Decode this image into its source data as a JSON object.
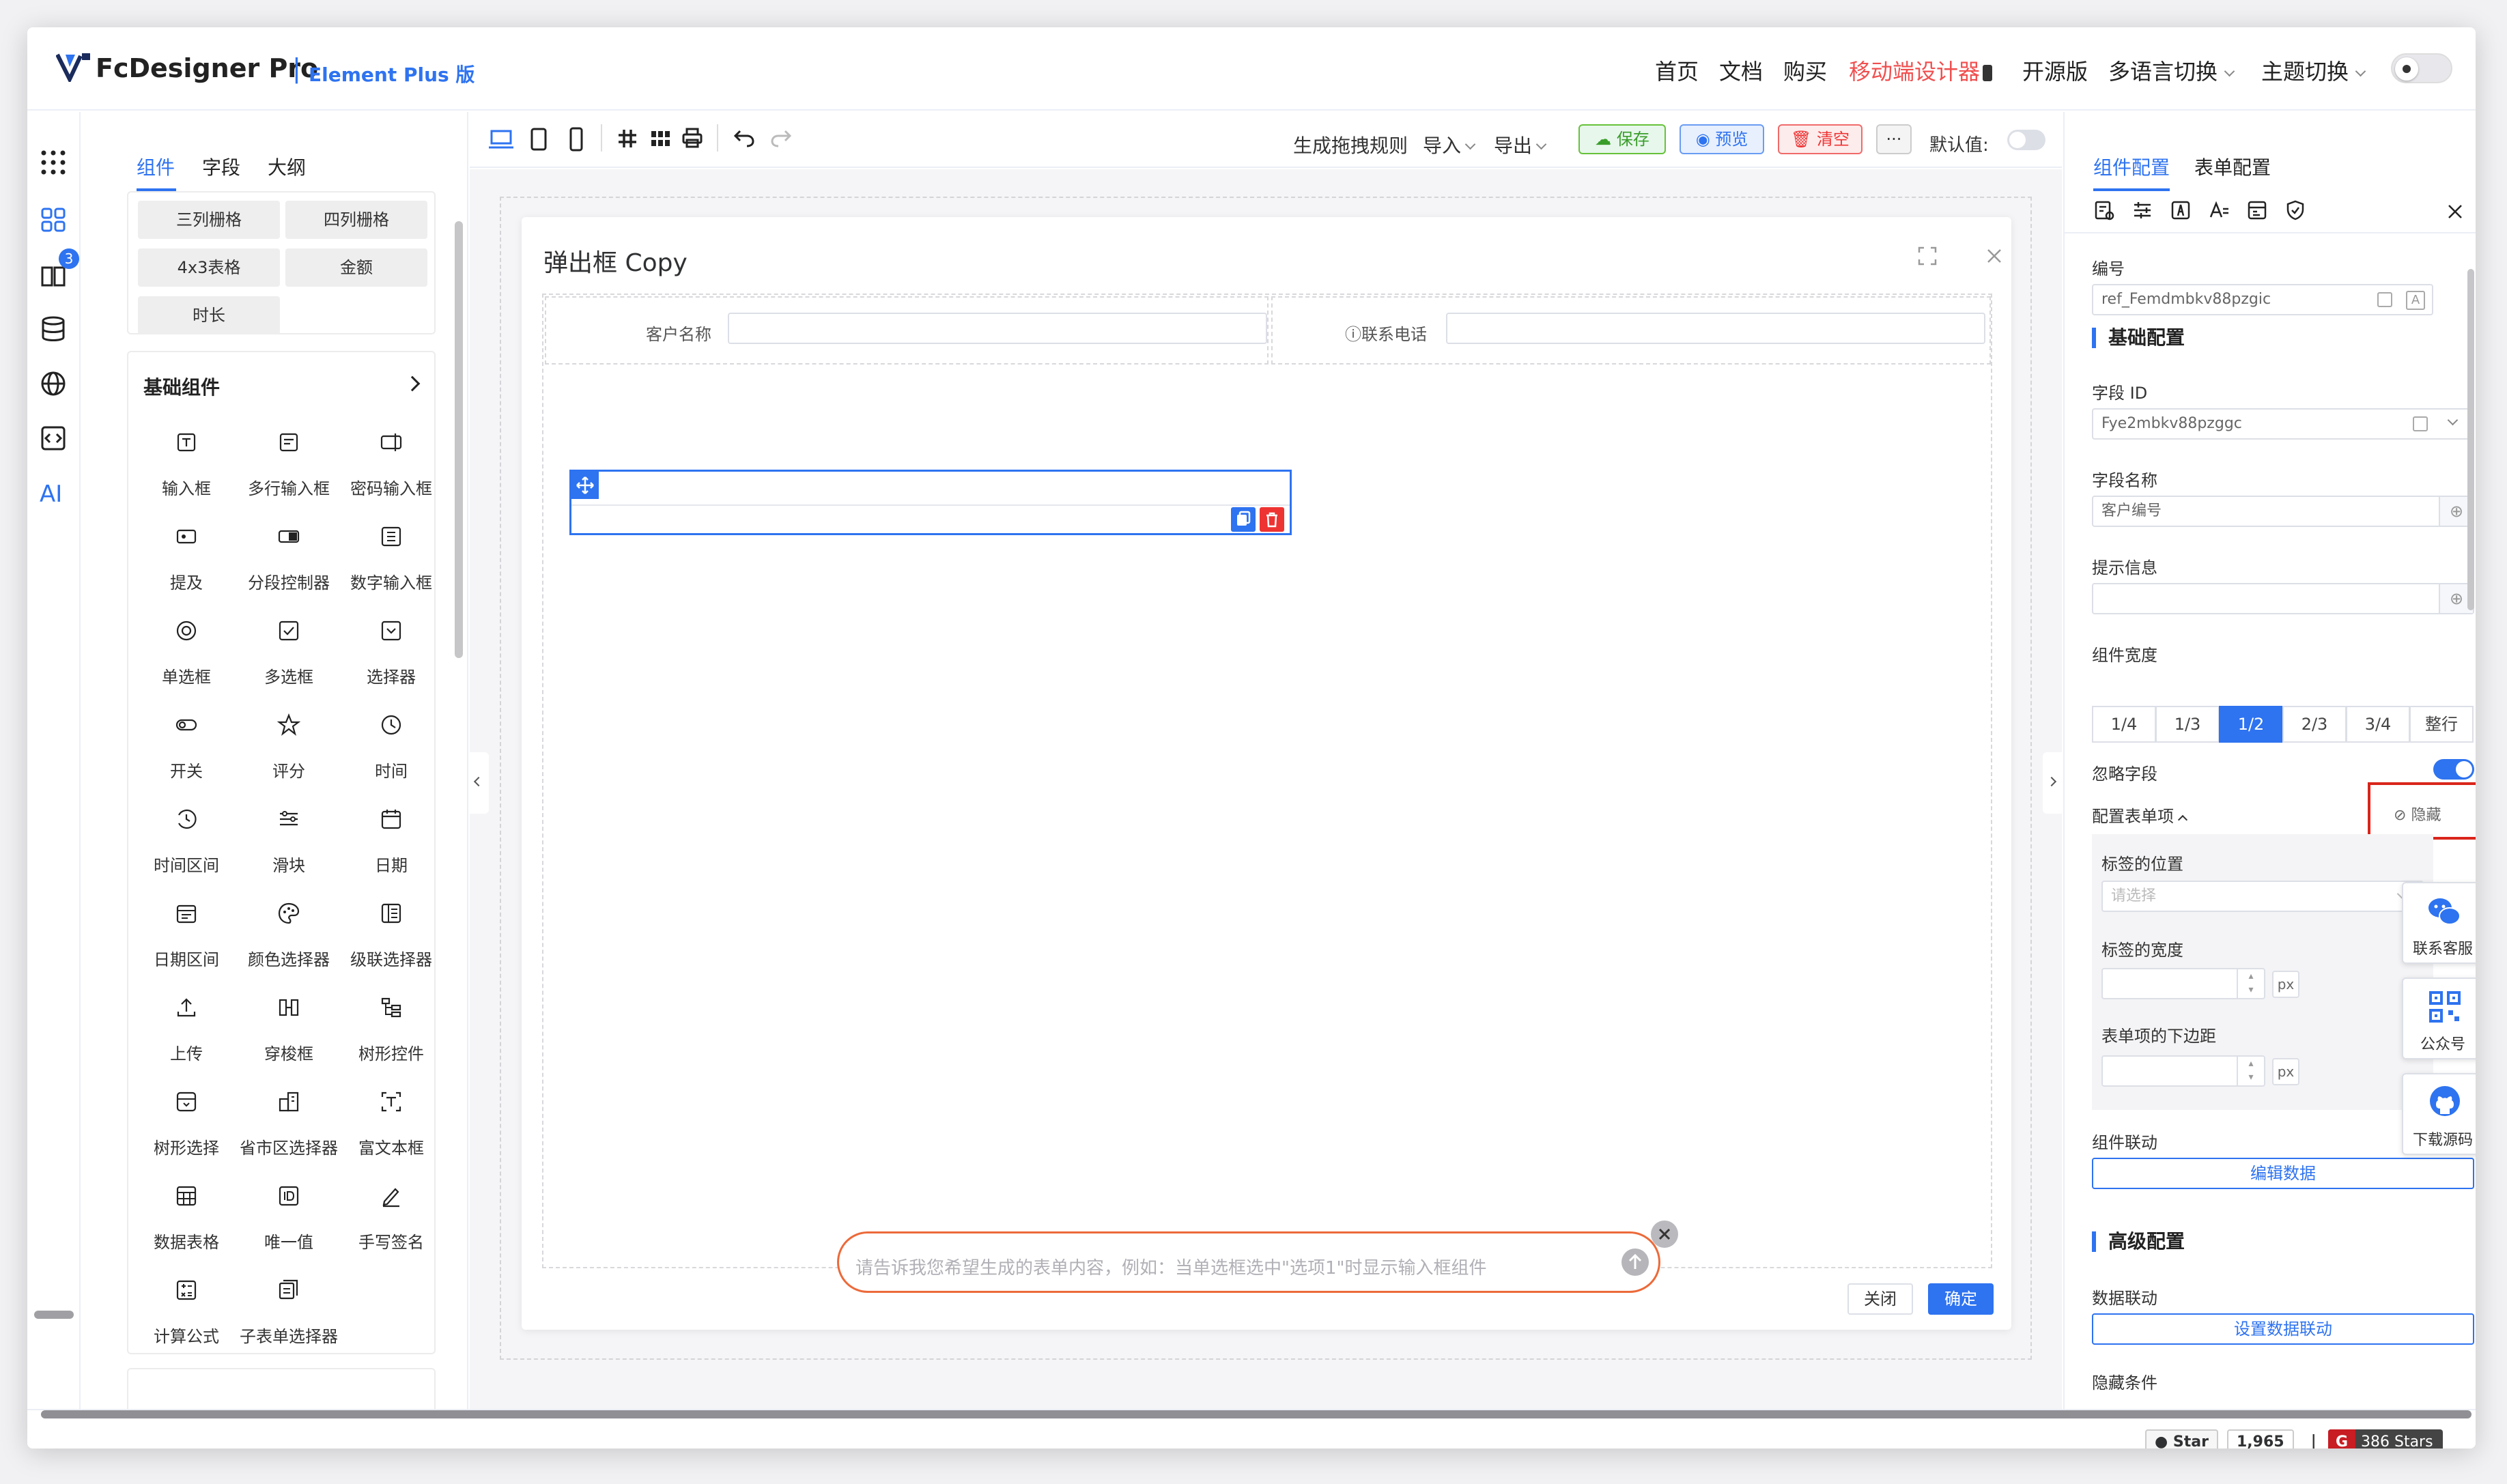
{
  "app": {
    "title": "FcDesigner Pro",
    "sep": "|",
    "subtitle": "Element Plus 版"
  },
  "topnav": {
    "items": [
      "首页",
      "文档",
      "购买",
      "移动端设计器",
      "开源版",
      "多语言切换",
      "主题切换"
    ],
    "active_color": "#f04f4f"
  },
  "left": {
    "tabs": [
      "组件",
      "字段",
      "大纲"
    ],
    "badge": "3",
    "ai_label": "AI",
    "layout_chips": [
      "三列栅格",
      "四列栅格",
      "4x3表格",
      "金额",
      "时长"
    ],
    "basic_title": "基础组件",
    "components": [
      {
        "label": "输入框",
        "icon": "input-icon"
      },
      {
        "label": "多行输入框",
        "icon": "textarea-icon"
      },
      {
        "label": "密码输入框",
        "icon": "password-icon"
      },
      {
        "label": "提及",
        "icon": "mention-icon"
      },
      {
        "label": "分段控制器",
        "icon": "segmented-icon"
      },
      {
        "label": "数字输入框",
        "icon": "number-icon"
      },
      {
        "label": "单选框",
        "icon": "radio-icon"
      },
      {
        "label": "多选框",
        "icon": "checkbox-icon"
      },
      {
        "label": "选择器",
        "icon": "select-icon"
      },
      {
        "label": "开关",
        "icon": "switch-icon"
      },
      {
        "label": "评分",
        "icon": "star-icon"
      },
      {
        "label": "时间",
        "icon": "clock-icon"
      },
      {
        "label": "时间区间",
        "icon": "time-range-icon"
      },
      {
        "label": "滑块",
        "icon": "slider-icon"
      },
      {
        "label": "日期",
        "icon": "calendar-icon"
      },
      {
        "label": "日期区间",
        "icon": "date-range-icon"
      },
      {
        "label": "颜色选择器",
        "icon": "palette-icon"
      },
      {
        "label": "级联选择器",
        "icon": "cascader-icon"
      },
      {
        "label": "上传",
        "icon": "upload-icon"
      },
      {
        "label": "穿梭框",
        "icon": "transfer-icon"
      },
      {
        "label": "树形控件",
        "icon": "tree-icon"
      },
      {
        "label": "树形选择",
        "icon": "tree-select-icon"
      },
      {
        "label": "省市区选择器",
        "icon": "region-icon"
      },
      {
        "label": "富文本框",
        "icon": "editor-icon"
      },
      {
        "label": "数据表格",
        "icon": "table-icon"
      },
      {
        "label": "唯一值",
        "icon": "id-icon"
      },
      {
        "label": "手写签名",
        "icon": "signature-icon"
      },
      {
        "label": "计算公式",
        "icon": "calculator-icon"
      },
      {
        "label": "子表单选择器",
        "icon": "subform-icon"
      }
    ]
  },
  "toolbar": {
    "gen_rule": "生成拖拽规则",
    "import": "导入",
    "export": "导出",
    "save": "保存",
    "preview": "预览",
    "clear": "清空",
    "more": "···",
    "default_label": "默认值:"
  },
  "canvas": {
    "dialog_title": "弹出框 Copy",
    "field1_label": "客户名称",
    "field2_label": "ⓘ联系电话",
    "close_btn": "关闭",
    "ok_btn": "确定",
    "ai_placeholder": "请告诉我您希望生成的表单内容，例如：当单选框选中\"选项1\"时显示输入框组件"
  },
  "right": {
    "tabs": [
      "组件配置",
      "表单配置"
    ],
    "ref_label": "编号",
    "ref_value": "ref_Femdmbkv88pzgic",
    "basic_section": "基础配置",
    "field_id_label": "字段 ID",
    "field_id_value": "Fye2mbkv88pzggc",
    "field_name_label": "字段名称",
    "field_name_value": "客户编号",
    "tip_label": "提示信息",
    "width_label": "组件宽度",
    "widths": [
      "1/4",
      "1/3",
      "1/2",
      "2/3",
      "3/4",
      "整行"
    ],
    "width_selected": "1/2",
    "ignore_label": "忽略字段",
    "ignore_on": true,
    "config_label": "配置表单项",
    "hide_label": "隐藏",
    "label_pos_label": "标签的位置",
    "label_pos_placeholder": "请选择",
    "label_width_label": "标签的宽度",
    "px": "px",
    "margin_label": "表单项的下边距",
    "link_label": "组件联动",
    "edit_data": "编辑数据",
    "adv_section": "高级配置",
    "data_link_label": "数据联动",
    "set_data_link": "设置数据联动",
    "hide_cond_label": "隐藏条件",
    "side_cards": [
      "联系客服",
      "公众号",
      "下载源码"
    ]
  },
  "footer": {
    "star_label": "Star",
    "star_count": "1,965",
    "sep": "|",
    "gitee_stars": "386 Stars"
  }
}
